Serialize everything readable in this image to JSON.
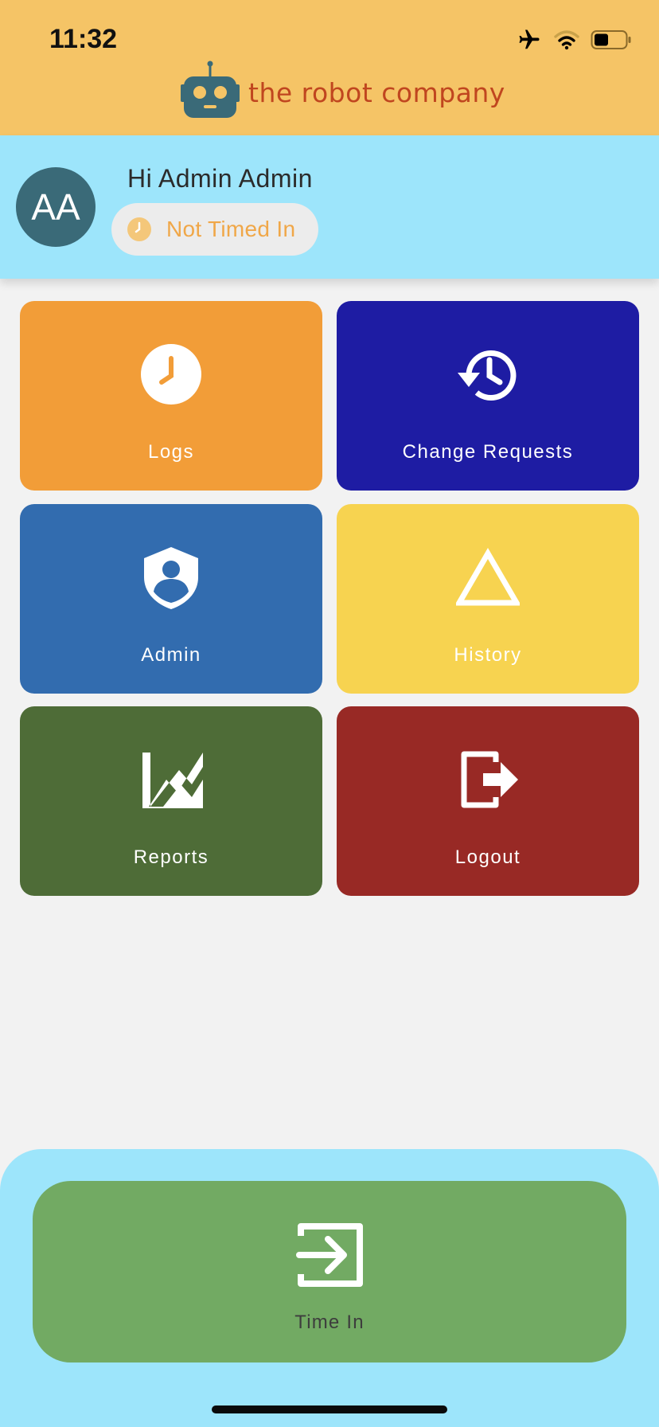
{
  "status_bar": {
    "time": "11:32",
    "icons": [
      "airplane-icon",
      "wifi-icon",
      "battery-icon"
    ]
  },
  "brand": {
    "name": "the robot company",
    "logo_icon": "robot-icon",
    "color": "#c0461f"
  },
  "user": {
    "initials": "AA",
    "greeting": "Hi Admin Admin",
    "time_status": "Not Timed In"
  },
  "tiles": [
    {
      "label": "Logs",
      "icon": "clock-icon",
      "color": "#f29d38"
    },
    {
      "label": "Change Requests",
      "icon": "history-icon",
      "color": "#1e1ca3"
    },
    {
      "label": "Admin",
      "icon": "admin-shield-icon",
      "color": "#326caf"
    },
    {
      "label": "History",
      "icon": "triangle-icon",
      "color": "#f7d350"
    },
    {
      "label": "Reports",
      "icon": "chart-icon",
      "color": "#4e6c37"
    },
    {
      "label": "Logout",
      "icon": "logout-icon",
      "color": "#982925"
    }
  ],
  "time_in": {
    "label": "Time In",
    "icon": "login-icon",
    "color": "#72aa63"
  },
  "colors": {
    "header": "#f5c466",
    "user_bar": "#9de5fb",
    "background": "#f2f2f2"
  }
}
